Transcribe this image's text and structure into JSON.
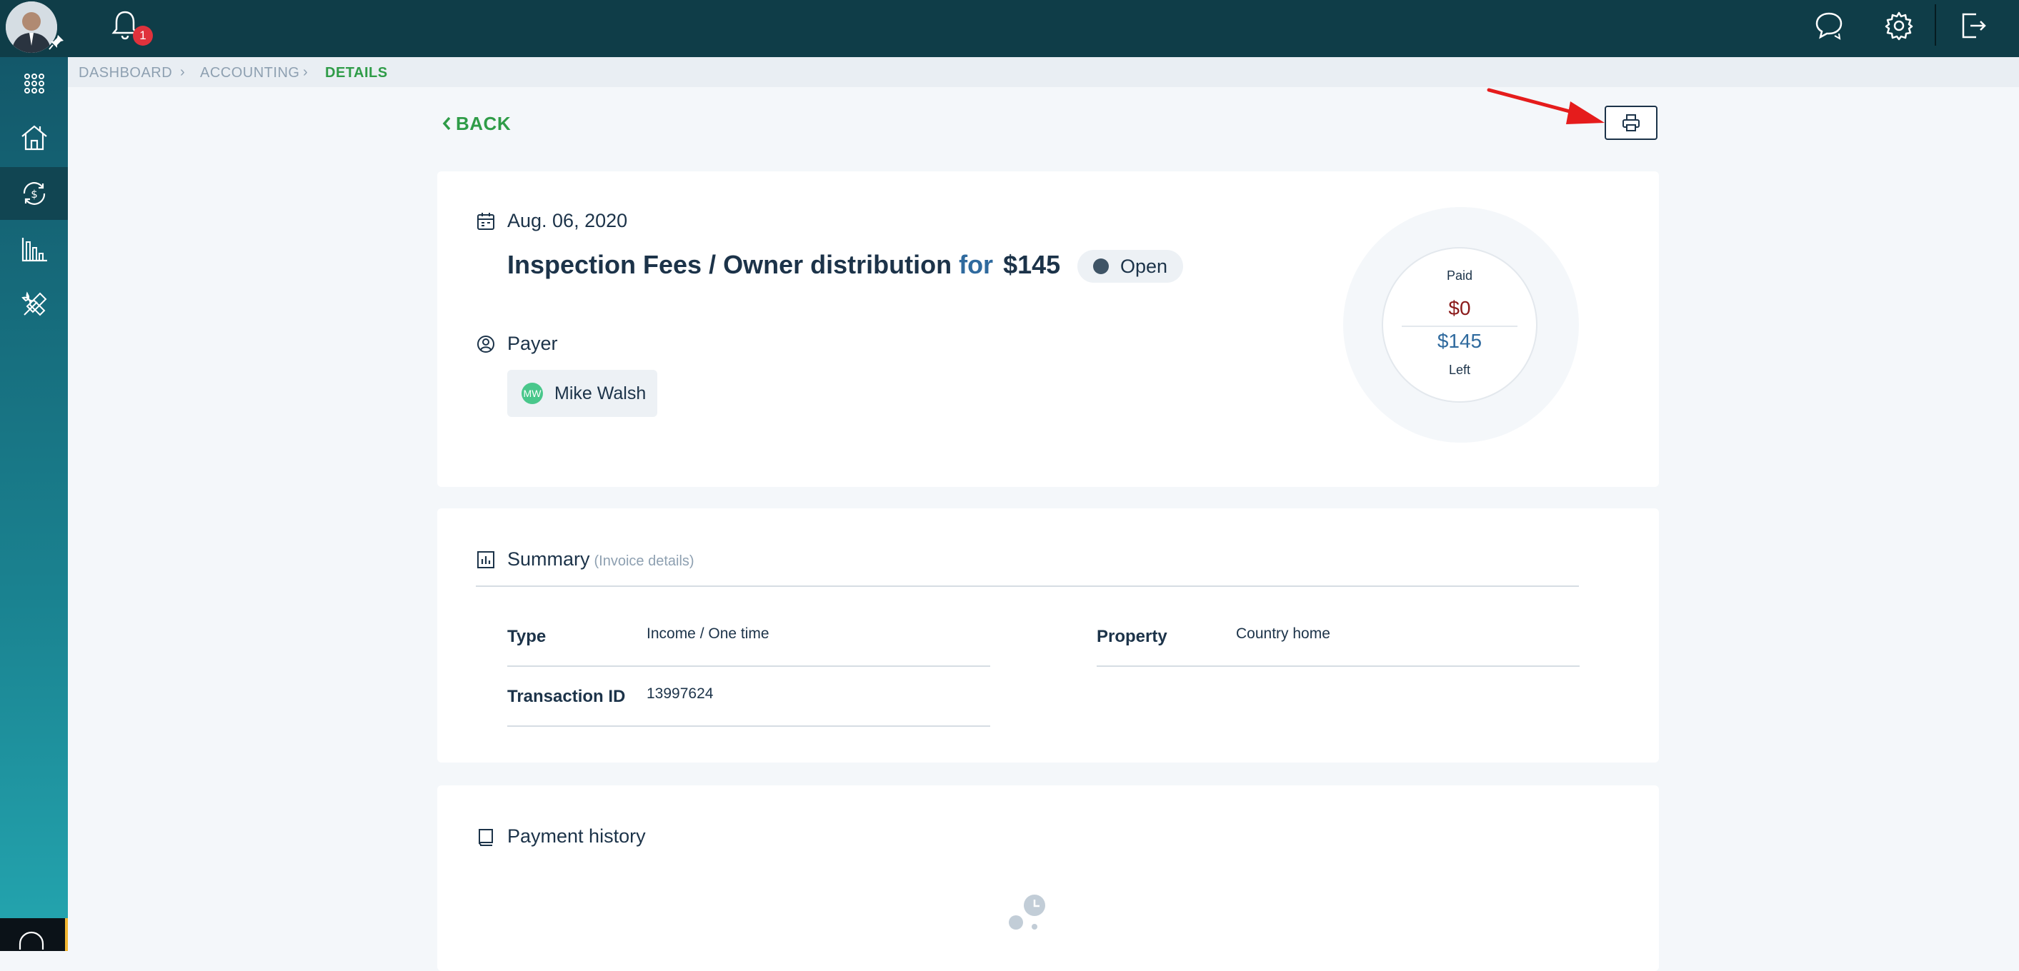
{
  "topbar": {
    "notification_count": "1"
  },
  "breadcrumb": {
    "items": [
      "DASHBOARD",
      "ACCOUNTING",
      "DETAILS"
    ],
    "separator": "›"
  },
  "actions": {
    "back_label": "BACK"
  },
  "transaction": {
    "date": "Aug. 06, 2020",
    "title": "Inspection Fees / Owner distribution",
    "for_label": "for",
    "amount": "$145",
    "status": "Open",
    "payer_label": "Payer",
    "payer_initials": "MW",
    "payer_name": "Mike Walsh"
  },
  "payment_ring": {
    "paid_label": "Paid",
    "paid_value": "$0",
    "left_value": "$145",
    "left_label": "Left"
  },
  "summary": {
    "title": "Summary",
    "subtitle": "(Invoice details)",
    "fields": {
      "type_label": "Type",
      "type_value": "Income / One time",
      "property_label": "Property",
      "property_value": "Country home",
      "txn_label": "Transaction ID",
      "txn_value": "13997624"
    }
  },
  "payment_history": {
    "title": "Payment history"
  },
  "colors": {
    "topbar": "#0f3d48",
    "accent_green": "#2f9c48",
    "badge_red": "#e0323c",
    "paid_red": "#8b1a1a",
    "left_blue": "#2f6a9e"
  }
}
